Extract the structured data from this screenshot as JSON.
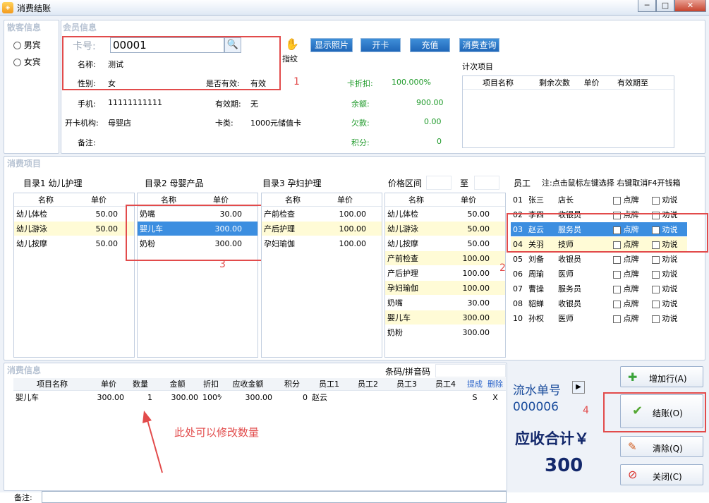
{
  "window": {
    "title": "消费结账",
    "min": "─",
    "max": "□",
    "close": "✕"
  },
  "guest": {
    "title": "散客信息",
    "male": "男宾",
    "female": "女宾"
  },
  "member": {
    "title": "会员信息",
    "card_label": "卡号:",
    "card_value": "00001",
    "finger_label": "指纹",
    "name_label": "名称:",
    "name": "测试",
    "gender_label": "性别:",
    "gender": "女",
    "valid_label": "是否有效:",
    "valid": "有效",
    "phone_label": "手机:",
    "phone": "11111111111",
    "expiry_label": "有效期:",
    "expiry": "无",
    "org_label": "开卡机构:",
    "org": "母婴店",
    "cardtype_label": "卡类:",
    "cardtype": "1000元储值卡",
    "note_label": "备注:",
    "discount_label": "卡折扣:",
    "discount": "100.000%",
    "balance_label": "余额:",
    "balance": "900.00",
    "debt_label": "欠款:",
    "debt": "0.00",
    "points_label": "积分:",
    "points": "0",
    "btn_photo": "显示照片",
    "btn_open": "开卡",
    "btn_recharge": "充值",
    "btn_query": "消费查询",
    "count_title": "计次项目",
    "count_cols": [
      "项目名称",
      "剩余次数",
      "单价",
      "有效期至"
    ]
  },
  "items": {
    "title": "消费项目",
    "cat1": {
      "label": "目录1 幼儿护理",
      "cols": [
        "名称",
        "单价"
      ],
      "rows": [
        [
          "幼儿体检",
          "50.00"
        ],
        [
          "幼儿游泳",
          "50.00"
        ],
        [
          "幼儿按摩",
          "50.00"
        ]
      ]
    },
    "cat2": {
      "label": "目录2 母婴产品",
      "cols": [
        "名称",
        "单价"
      ],
      "rows": [
        [
          "奶嘴",
          "30.00"
        ],
        [
          "婴儿车",
          "300.00"
        ],
        [
          "奶粉",
          "300.00"
        ]
      ]
    },
    "cat3": {
      "label": "目录3 孕妇护理",
      "cols": [
        "名称",
        "单价"
      ],
      "rows": [
        [
          "产前检查",
          "100.00"
        ],
        [
          "产后护理",
          "100.00"
        ],
        [
          "孕妇瑜伽",
          "100.00"
        ]
      ]
    },
    "price_range_label": "价格区间",
    "price_to": "至",
    "all": {
      "cols": [
        "名称",
        "单价"
      ],
      "rows": [
        [
          "幼儿体检",
          "50.00"
        ],
        [
          "幼儿游泳",
          "50.00"
        ],
        [
          "幼儿按摩",
          "50.00"
        ],
        [
          "产前检查",
          "100.00"
        ],
        [
          "产后护理",
          "100.00"
        ],
        [
          "孕妇瑜伽",
          "100.00"
        ],
        [
          "奶嘴",
          "30.00"
        ],
        [
          "婴儿车",
          "300.00"
        ],
        [
          "奶粉",
          "300.00"
        ]
      ]
    },
    "staff_label": "员工",
    "staff_hint": "注:点击鼠标左键选择 右键取消F4开钱箱",
    "staff": [
      [
        "01",
        "张三",
        "店长"
      ],
      [
        "02",
        "李四",
        "收银员"
      ],
      [
        "03",
        "赵云",
        "服务员"
      ],
      [
        "04",
        "关羽",
        "技师"
      ],
      [
        "05",
        "刘备",
        "收银员"
      ],
      [
        "06",
        "周瑜",
        "医师"
      ],
      [
        "07",
        "曹操",
        "服务员"
      ],
      [
        "08",
        "貂蝉",
        "收银员"
      ],
      [
        "10",
        "孙权",
        "医师"
      ]
    ],
    "point_label": "点牌",
    "persuade_label": "劝说"
  },
  "consume": {
    "title": "消费信息",
    "barcode_label": "条码/拼音码",
    "cols": [
      "项目名称",
      "单价",
      "数量",
      "金额",
      "折扣",
      "应收金额",
      "积分",
      "员工1",
      "员工2",
      "员工3",
      "员工4",
      "提成",
      "删除"
    ],
    "row": [
      "婴儿车",
      "300.00",
      "1",
      "300.00",
      "100%",
      "300.00",
      "0",
      "赵云",
      "",
      "",
      "",
      "S",
      "X"
    ],
    "note_label": "备注:"
  },
  "summary": {
    "serial_label": "流水单号",
    "serial": "000006",
    "receivable_label": "应收合计￥",
    "receivable": "300"
  },
  "actions": {
    "add": "增加行(A)",
    "checkout": "结账(O)",
    "clear": "清除(Q)",
    "close": "关闭(C)"
  },
  "annotations": {
    "a1": "1",
    "a2": "2",
    "a3": "3",
    "a4": "4",
    "note": "此处可以修改数量"
  }
}
